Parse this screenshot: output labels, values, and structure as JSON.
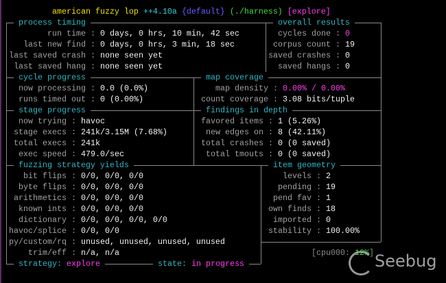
{
  "title": {
    "app": "american fuzzy lop",
    "version": "++4.10a",
    "instance": "{default}",
    "target": "(./harness)",
    "mode": "[explore]"
  },
  "colors": {
    "title": "#f0e000",
    "version": "#2fd0d8",
    "instance": "#6a5cff",
    "target": "#3cdc3c",
    "mode": "#ff3cf0",
    "header": "#2fb6c4",
    "highlight": "#ff3cf0",
    "cpu": "#3cdc3c"
  },
  "process_timing": {
    "header": "process timing",
    "rows": [
      {
        "label": "run time",
        "value": "0 days, 0 hrs, 10 min, 42 sec"
      },
      {
        "label": "last new find",
        "value": "0 days, 0 hrs, 3 min, 18 sec"
      },
      {
        "label": "last saved crash",
        "value": "none seen yet"
      },
      {
        "label": "last saved hang",
        "value": "none seen yet"
      }
    ]
  },
  "overall_results": {
    "header": "overall results",
    "rows": [
      {
        "label": "cycles done",
        "value": "0"
      },
      {
        "label": "corpus count",
        "value": "19"
      },
      {
        "label": "saved crashes",
        "value": "0"
      },
      {
        "label": "saved hangs",
        "value": "0"
      }
    ]
  },
  "cycle_progress": {
    "header": "cycle progress",
    "rows": [
      {
        "label": "now processing",
        "value": "0.0 (0.0%)"
      },
      {
        "label": "runs timed out",
        "value": "0 (0.00%)"
      }
    ]
  },
  "map_coverage": {
    "header": "map coverage",
    "rows": [
      {
        "label": "map density",
        "value": "0.00% / 0.00%"
      },
      {
        "label": "count coverage",
        "value": "3.08 bits/tuple"
      }
    ]
  },
  "stage_progress": {
    "header": "stage progress",
    "rows": [
      {
        "label": "now trying",
        "value": "havoc"
      },
      {
        "label": "stage execs",
        "value": "241k/3.15M (7.68%)"
      },
      {
        "label": "total execs",
        "value": "241k"
      },
      {
        "label": "exec speed",
        "value": "479.0/sec"
      }
    ]
  },
  "findings_in_depth": {
    "header": "findings in depth",
    "rows": [
      {
        "label": "favored items",
        "value": "1 (5.26%)"
      },
      {
        "label": "new edges on",
        "value": "8 (42.11%)"
      },
      {
        "label": "total crashes",
        "value": "0 (0 saved)"
      },
      {
        "label": "total tmouts",
        "value": "0 (0 saved)"
      }
    ]
  },
  "fuzzing_strategy_yields": {
    "header": "fuzzing strategy yields",
    "rows": [
      {
        "label": "bit flips",
        "value": "0/0, 0/0, 0/0"
      },
      {
        "label": "byte flips",
        "value": "0/0, 0/0, 0/0"
      },
      {
        "label": "arithmetics",
        "value": "0/0, 0/0, 0/0"
      },
      {
        "label": "known ints",
        "value": "0/0, 0/0, 0/0"
      },
      {
        "label": "dictionary",
        "value": "0/0, 0/0, 0/0, 0/0"
      },
      {
        "label": "havoc/splice",
        "value": "0/0, 0/0"
      },
      {
        "label": "py/custom/rq",
        "value": "unused, unused, unused, unused"
      },
      {
        "label": "trim/eff",
        "value": "n/a, n/a"
      }
    ]
  },
  "item_geometry": {
    "header": "item geometry",
    "rows": [
      {
        "label": "levels",
        "value": "2"
      },
      {
        "label": "pending",
        "value": "19"
      },
      {
        "label": "pend fav",
        "value": "1"
      },
      {
        "label": "own finds",
        "value": "18"
      },
      {
        "label": "imported",
        "value": "0"
      },
      {
        "label": "stability",
        "value": "100.00%"
      }
    ]
  },
  "footer": {
    "strategy_label": "strategy:",
    "strategy_value": "explore",
    "state_label": "state:",
    "state_value": "in progress"
  },
  "cpu": {
    "label": "[cpu000:",
    "value": "12%",
    "close": "]"
  },
  "watermark": "Seebug"
}
